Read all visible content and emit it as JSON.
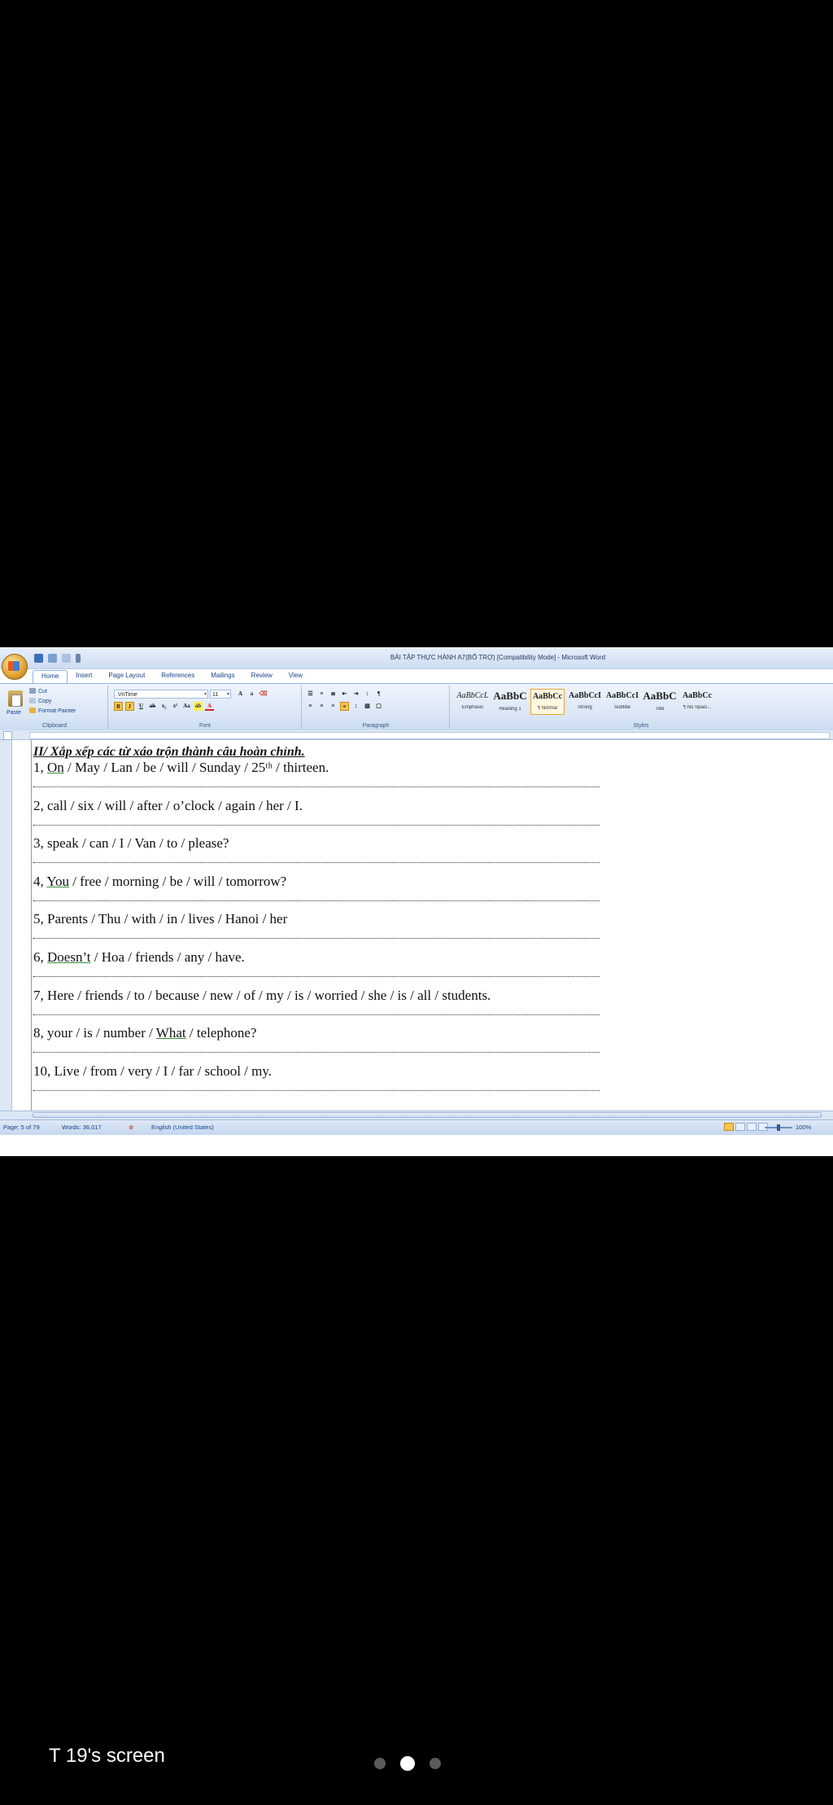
{
  "window": {
    "title": "BÀI TẬP THỰC HÀNH A7(BỔ TRỢ) [Compatibility Mode] - Microsoft Word"
  },
  "ribbon": {
    "tabs": [
      "Home",
      "Insert",
      "Page Layout",
      "References",
      "Mailings",
      "Review",
      "View"
    ],
    "clipboard": {
      "paste_label": "Paste",
      "cut_label": "Cut",
      "copy_label": "Copy",
      "format_painter_label": "Format Painter",
      "group_label": "Clipboard"
    },
    "font": {
      "font_name": ".VnTime",
      "font_size": "11",
      "group_label": "Font"
    },
    "paragraph": {
      "group_label": "Paragraph"
    },
    "styles": {
      "group_label": "Styles",
      "items": [
        {
          "sample": "AaBbCcL",
          "name": "Emphasis"
        },
        {
          "sample": "AaBbC",
          "name": "Heading 1"
        },
        {
          "sample": "AaBbCc",
          "name": "¶ Normal"
        },
        {
          "sample": "AaBbCcI",
          "name": "Strong"
        },
        {
          "sample": "AaBbCcI",
          "name": "Subtitle"
        },
        {
          "sample": "AaBbC",
          "name": "Title"
        },
        {
          "sample": "AaBbCc",
          "name": "¶ No Spaci..."
        }
      ]
    }
  },
  "document": {
    "heading": "II/ Xắp xếp các từ xáo trộn thành câu hoàn chỉnh.",
    "lines": [
      {
        "pre": "1, ",
        "u": "On",
        "post": " / May / Lan / be / will / Sunday / 25ᵗʰ / thirteen."
      },
      {
        "pre": "2, call / six / will / after / o’clock / again / her / I.",
        "u": "",
        "post": ""
      },
      {
        "pre": "3, speak / can / I / Van / to / please?",
        "u": "",
        "post": ""
      },
      {
        "pre": "4, ",
        "u": "You",
        "post": " / free / morning / be / will / tomorrow?"
      },
      {
        "pre": "5, Parents / Thu / with / in / lives / Hanoi / her",
        "u": "",
        "post": ""
      },
      {
        "pre": "6, ",
        "u": "Doesn’t",
        "post": " / Hoa / friends / any / have."
      },
      {
        "pre": "7, Here / friends / to / because / new / of / my / is / worried / she / is / all / students.",
        "u": "",
        "post": ""
      },
      {
        "pre": "8, your / is / number / ",
        "u": "What",
        "post": " / telephone?"
      },
      {
        "pre": "10, Live / from / very / I / far / school / my.",
        "u": "",
        "post": ""
      }
    ]
  },
  "status": {
    "page": "Page: 5 of 79",
    "words": "Words: 36,017",
    "language": "English (United States)",
    "zoom": "100%"
  },
  "overlay": {
    "screen_label": "T 19's screen"
  }
}
